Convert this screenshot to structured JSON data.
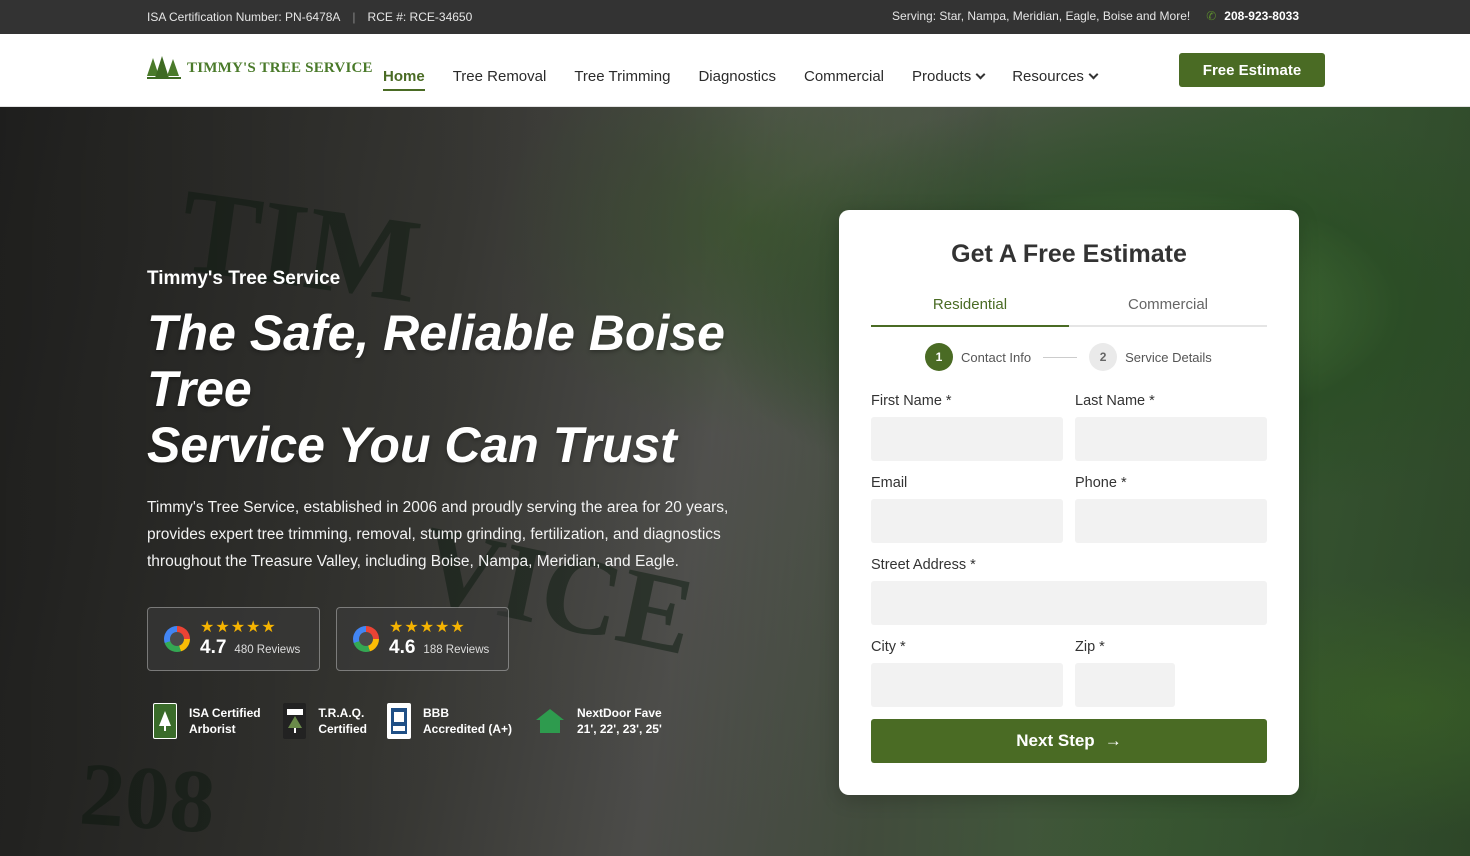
{
  "topbar": {
    "isa": "ISA Certification Number: PN-6478A",
    "separator": "|",
    "rce": "RCE #: RCE-34650",
    "serving": "Serving: Star, Nampa, Meridian, Eagle, Boise and More!",
    "phone": "208-923-8033",
    "phone_icon": "phone-icon"
  },
  "header": {
    "logo_text": "TIMMY'S TREE SERVICE",
    "nav": [
      {
        "label": "Home",
        "active": true
      },
      {
        "label": "Tree Removal"
      },
      {
        "label": "Tree Trimming"
      },
      {
        "label": "Diagnostics"
      },
      {
        "label": "Commercial"
      },
      {
        "label": "Products",
        "dropdown": true
      },
      {
        "label": "Resources",
        "dropdown": true
      }
    ],
    "cta": "Free Estimate"
  },
  "hero": {
    "subtitle": "Timmy's Tree Service",
    "title_line1": "The Safe, Reliable Boise",
    "title_line2": "Tree",
    "title_line3": "Service You Can Trust",
    "description": "Timmy's Tree Service, established in 2006 and proudly serving the area for 20 years, provides expert tree trimming, removal, stump grinding, fertilization, and diagnostics throughout the Treasure Valley, including Boise, Nampa, Meridian, and Eagle.",
    "reviews": [
      {
        "stars": "★★★★★",
        "rating": "4.7",
        "count": "480 Reviews"
      },
      {
        "stars": "★★★★★",
        "rating": "4.6",
        "count": "188 Reviews"
      }
    ],
    "badges": [
      {
        "line1": "ISA Certified",
        "line2": "Arborist",
        "icon": "isa-badge-icon",
        "color": "#3a6b2a"
      },
      {
        "line1": "T.R.A.Q.",
        "line2": "Certified",
        "icon": "traq-badge-icon",
        "color": "#222222"
      },
      {
        "line1": "BBB",
        "line2": "Accredited (A+)",
        "icon": "bbb-badge-icon",
        "color": "#1f4f86"
      },
      {
        "line1": "NextDoor Fave",
        "line2": "21', 22', 23', 25'",
        "icon": "nextdoor-house-icon",
        "color": "#2e9b4e"
      }
    ]
  },
  "form": {
    "title": "Get A Free Estimate",
    "tabs": [
      "Residential",
      "Commercial"
    ],
    "steps": [
      {
        "num": "1",
        "label": "Contact Info"
      },
      {
        "num": "2",
        "label": "Service Details"
      }
    ],
    "labels": {
      "first_name": "First Name *",
      "last_name": "Last Name *",
      "email": "Email",
      "phone": "Phone *",
      "street": "Street Address *",
      "city": "City *",
      "zip": "Zip *"
    },
    "next_button": "Next Step",
    "arrow": "→"
  },
  "colors": {
    "brand_green": "#4a6b24",
    "topbar_bg": "#333333",
    "star_gold": "#f5b301"
  }
}
